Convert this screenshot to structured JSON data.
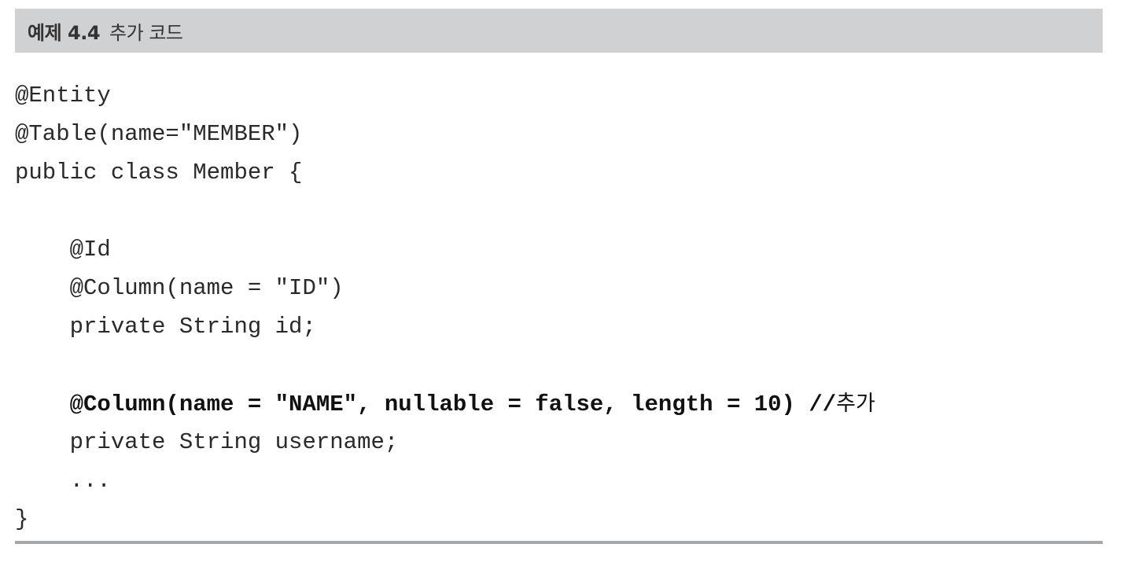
{
  "example": {
    "label": "예제 4.4",
    "title": "추가 코드"
  },
  "code": {
    "lines": [
      {
        "text": "@Entity",
        "bold": false
      },
      {
        "text": "@Table(name=\"MEMBER\")",
        "bold": false
      },
      {
        "text": "public class Member {",
        "bold": false
      },
      {
        "text": "",
        "bold": false
      },
      {
        "text": "    @Id",
        "bold": false
      },
      {
        "text": "    @Column(name = \"ID\")",
        "bold": false
      },
      {
        "text": "    private String id;",
        "bold": false
      },
      {
        "text": "",
        "bold": false
      },
      {
        "text": "    @Column(name = \"NAME\", nullable = false, length = 10) //",
        "bold": true,
        "comment": "추가"
      },
      {
        "text": "    private String username;",
        "bold": false
      },
      {
        "text": "    ...",
        "bold": false
      },
      {
        "text": "}",
        "bold": false
      }
    ]
  }
}
